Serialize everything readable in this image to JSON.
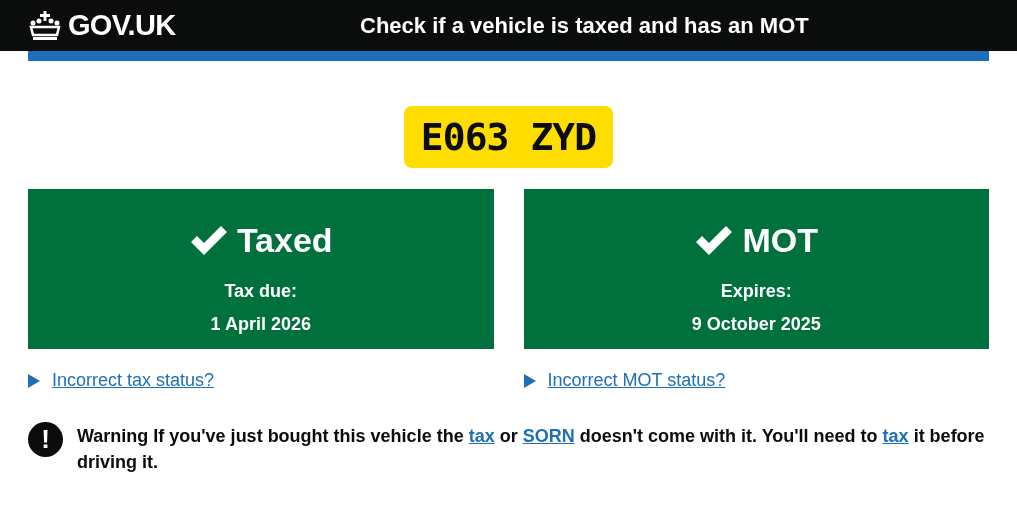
{
  "header": {
    "logo": "GOV.UK",
    "title": "Check if a vehicle is taxed and has an MOT"
  },
  "registration": "E063 ZYD",
  "statuses": [
    {
      "kind": "valid",
      "title": "Taxed",
      "label": "Tax due:",
      "date": "1 April 2026",
      "link": "Incorrect tax status?"
    },
    {
      "kind": "valid",
      "title": "MOT",
      "label": "Expires:",
      "date": "9 October 2025",
      "link": "Incorrect MOT status?"
    }
  ],
  "warning": {
    "icon": "!",
    "parts": [
      {
        "kind": "text",
        "text": "Warning If you've just bought this vehicle the "
      },
      {
        "kind": "link",
        "text": "tax"
      },
      {
        "kind": "text",
        "text": " or "
      },
      {
        "kind": "link",
        "text": "SORN"
      },
      {
        "kind": "text",
        "text": " doesn't come with it. You'll need to "
      },
      {
        "kind": "link",
        "text": "tax"
      },
      {
        "kind": "text",
        "text": " it before driving it."
      }
    ]
  }
}
